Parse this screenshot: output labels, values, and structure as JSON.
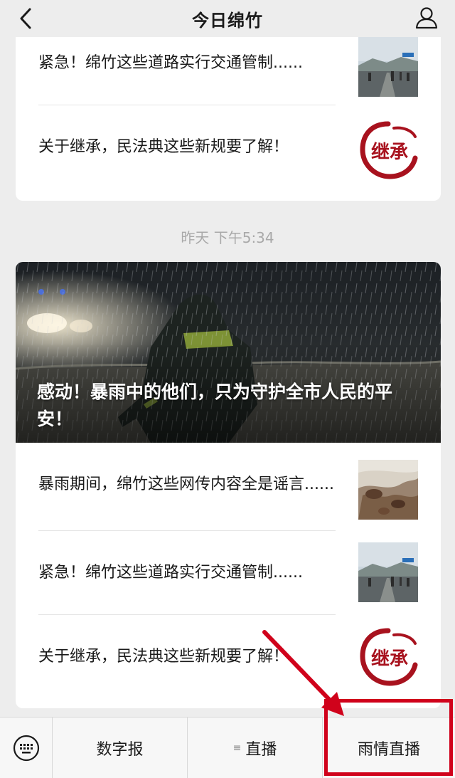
{
  "nav": {
    "title": "今日绵竹"
  },
  "feed": {
    "earlier_items": [
      {
        "title": "紧急！绵竹这些道路实行交通管制......",
        "thumb": "road-photo"
      },
      {
        "title": "关于继承，民法典这些新规要了解！",
        "thumb": "inheritance-logo"
      }
    ],
    "date_label": "昨天 下午5:34",
    "hero": {
      "title": "感动！暴雨中的他们，只为守护全市人民的平安！"
    },
    "items": [
      {
        "title": "暴雨期间，绵竹这些网传内容全是谣言......",
        "thumb": "flood-photo"
      },
      {
        "title": "紧急！绵竹这些道路实行交通管制......",
        "thumb": "road-photo"
      },
      {
        "title": "关于继承，民法典这些新规要了解！",
        "thumb": "inheritance-logo"
      }
    ],
    "logo_text": "继承"
  },
  "bottom_menu": {
    "items": [
      {
        "label": "数字报"
      },
      {
        "label": "直播"
      },
      {
        "label": "雨情直播"
      }
    ]
  },
  "colors": {
    "background": "#ededed",
    "card": "#ffffff",
    "annotation": "#d0021b",
    "logo": "#a8121e"
  }
}
